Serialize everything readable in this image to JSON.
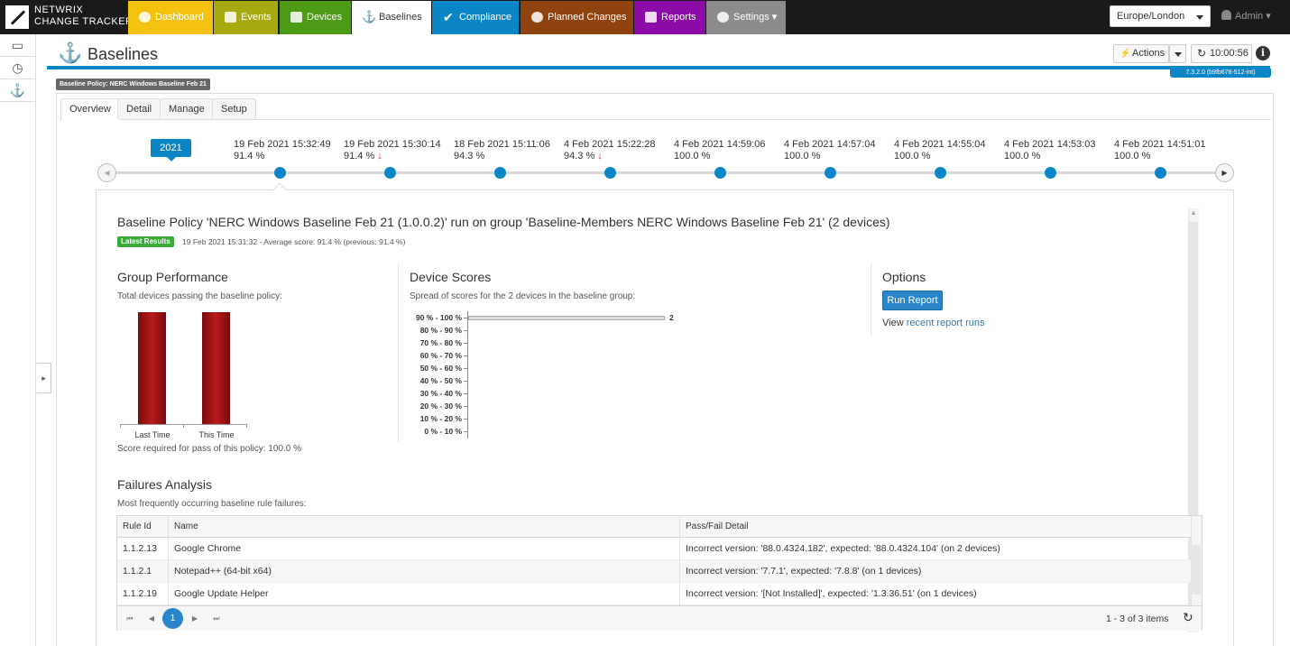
{
  "brand": {
    "line1": "NETWRIX",
    "line2": "CHANGE TRACKER"
  },
  "nav": [
    {
      "label": "Dashboard",
      "color": "#f4c10f"
    },
    {
      "label": "Events",
      "color": "#a8a810"
    },
    {
      "label": "Devices",
      "color": "#4d9a16"
    },
    {
      "label": "Baselines",
      "color": "#ffffff"
    },
    {
      "label": "Compliance",
      "color": "#0a86c6"
    },
    {
      "label": "Planned Changes",
      "color": "#8f4410"
    },
    {
      "label": "Reports",
      "color": "#8b0aa8"
    },
    {
      "label": "Settings ▾",
      "color": "#8c8c8c"
    }
  ],
  "timezone": "Europe/London",
  "user": "Admin ▾",
  "page": {
    "title": "Baselines",
    "actions_label": "Actions",
    "clock": "10:00:56",
    "info": "i",
    "version": "7.3.2.0 (b9fb678-512-int)"
  },
  "policy_badge": "Baseline Policy: NERC Windows Baseline Feb 21",
  "tabs": [
    "Overview",
    "Detail",
    "Manage",
    "Setup"
  ],
  "timeline": {
    "year": "2021",
    "runs": [
      {
        "date": "19 Feb 2021 15:32:49",
        "score": "91.4 %",
        "down": false
      },
      {
        "date": "19 Feb 2021 15:30:14",
        "score": "91.4 %",
        "down": true
      },
      {
        "date": "18 Feb 2021 15:11:06",
        "score": "94.3 %",
        "down": false
      },
      {
        "date": "4 Feb 2021 15:22:28",
        "score": "94.3 %",
        "down": true
      },
      {
        "date": "4 Feb 2021 14:59:06",
        "score": "100.0 %",
        "down": false
      },
      {
        "date": "4 Feb 2021 14:57:04",
        "score": "100.0 %",
        "down": false
      },
      {
        "date": "4 Feb 2021 14:55:04",
        "score": "100.0 %",
        "down": false
      },
      {
        "date": "4 Feb 2021 14:53:03",
        "score": "100.0 %",
        "down": false
      },
      {
        "date": "4 Feb 2021 14:51:01",
        "score": "100.0 %",
        "down": false
      }
    ]
  },
  "card": {
    "title": "Baseline Policy 'NERC Windows Baseline Feb 21 (1.0.0.2)' run on group 'Baseline-Members NERC Windows Baseline Feb 21' (2 devices)",
    "latest_badge": "Latest Results",
    "latest_text": "19 Feb 2021 15:31:32 - Average score: 91.4 % (previous: 91.4 %)"
  },
  "group_performance": {
    "title": "Group Performance",
    "subtitle": "Total devices passing the baseline policy:",
    "footer": "Score required for pass of this policy: 100.0 %"
  },
  "device_scores": {
    "title": "Device Scores",
    "subtitle": "Spread of scores for the 2 devices in the baseline group:"
  },
  "options": {
    "title": "Options",
    "run_button": "Run Report",
    "view_prefix": "View ",
    "view_link": "recent report runs"
  },
  "chart_data": [
    {
      "type": "bar",
      "categories": [
        "Last Time",
        "This Time"
      ],
      "values": [
        2,
        2
      ],
      "ylim": [
        0,
        2
      ]
    },
    {
      "type": "bar",
      "orientation": "horizontal",
      "categories": [
        "90 % - 100 %",
        "80 % - 90 %",
        "70 % - 80 %",
        "60 % - 70 %",
        "50 % - 60 %",
        "40 % - 50 %",
        "30 % - 40 %",
        "20 % - 30 %",
        "10 % - 20 %",
        "0 % - 10 %"
      ],
      "values": [
        2,
        0,
        0,
        0,
        0,
        0,
        0,
        0,
        0,
        0
      ],
      "data_labels": [
        "2",
        "",
        "",
        "",
        "",
        "",
        "",
        "",
        "",
        ""
      ],
      "xlim": [
        0,
        2
      ]
    }
  ],
  "failures": {
    "title": "Failures Analysis",
    "subtitle": "Most frequently occurring baseline rule failures:",
    "columns": [
      "Rule Id",
      "Name",
      "Pass/Fail Detail"
    ],
    "rows": [
      [
        "1.1.2.13",
        "Google Chrome",
        "Incorrect version: '88.0.4324.182', expected: '88.0.4324.104' (on 2 devices)"
      ],
      [
        "1.1.2.1",
        "Notepad++ (64-bit x64)",
        "Incorrect version: '7.7.1', expected: '7.8.8' (on 1 devices)"
      ],
      [
        "1.1.2.19",
        "Google Update Helper",
        "Incorrect version: '[Not Installed]', expected: '1.3.36.51' (on 1 devices)"
      ]
    ],
    "pager": {
      "current": "1",
      "info": "1 - 3 of 3 items"
    }
  }
}
